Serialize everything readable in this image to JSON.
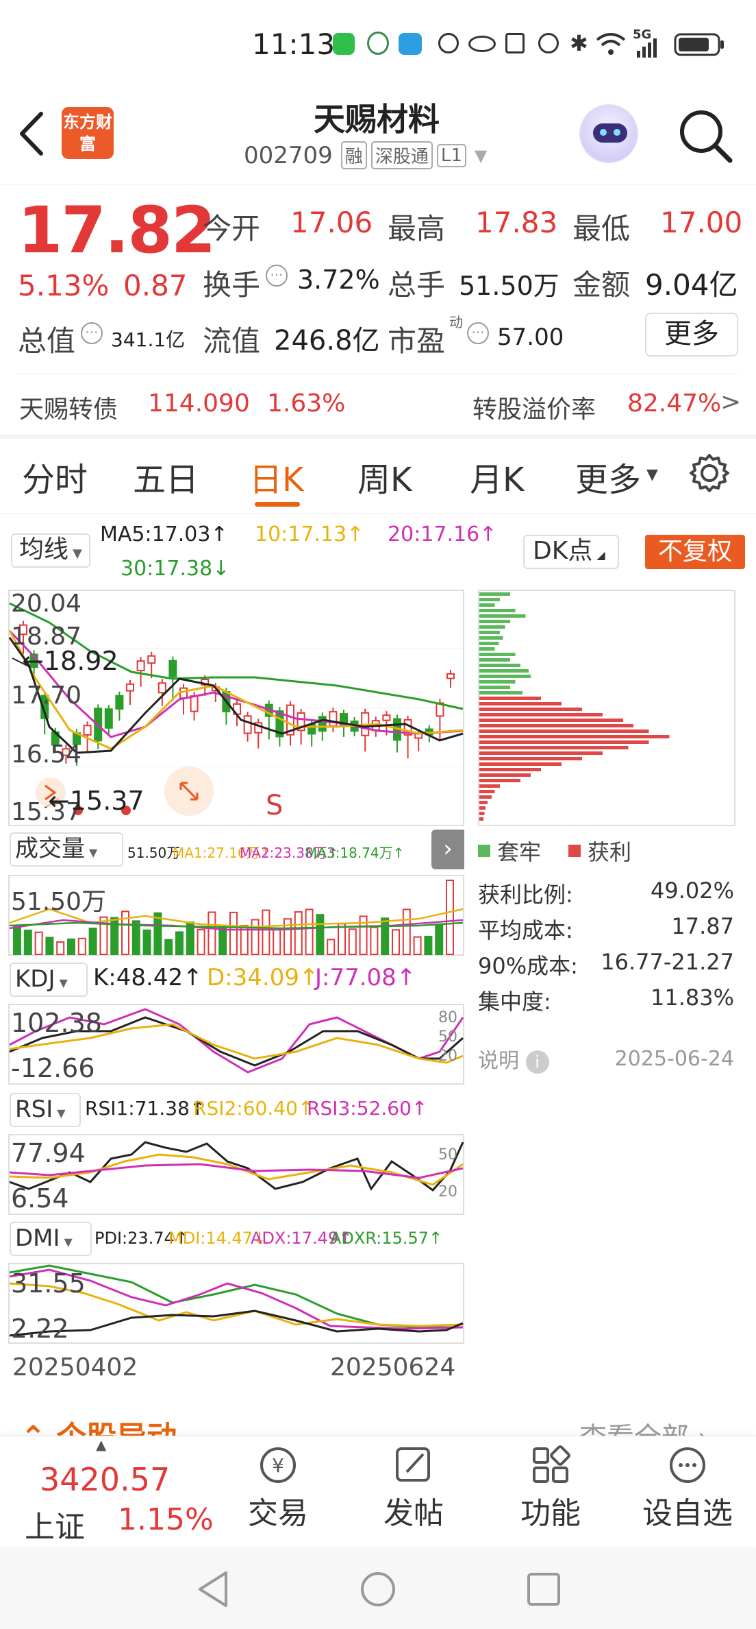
{
  "status_bar": {
    "time": "11:13",
    "network": "5G"
  },
  "header": {
    "logo_text": "东方财富",
    "stock_name": "天赐材料",
    "stock_code": "002709",
    "tags": [
      "融",
      "深股通",
      "L1"
    ]
  },
  "quote": {
    "price": "17.82",
    "change_pct": "5.13%",
    "change": "0.87",
    "open_label": "今开",
    "open": "17.06",
    "high_label": "最高",
    "high": "17.83",
    "low_label": "最低",
    "low": "17.00",
    "turnover_label": "换手",
    "turnover": "3.72%",
    "volume_label": "总手",
    "volume": "51.50万",
    "amount_label": "金额",
    "amount": "9.04亿",
    "mcap_label": "总值",
    "mcap": "341.1亿",
    "float_label": "流值",
    "float_val": "246.8亿",
    "pe_label": "市盈",
    "pe_sup": "动",
    "pe": "57.00",
    "more_label": "更多"
  },
  "bond": {
    "name": "天赐转债",
    "price": "114.090",
    "pct": "1.63%",
    "premium_label": "转股溢价率",
    "premium": "82.47%"
  },
  "tabs": [
    "分时",
    "五日",
    "日K",
    "周K",
    "月K",
    "更多"
  ],
  "active_tab": "日K",
  "ma_bar": {
    "selector": "均线",
    "ma5": "MA5:17.03↑",
    "ma10": "10:17.13↑",
    "ma20": "20:17.16↑",
    "ma30": "30:17.38↓",
    "dk": "DK点",
    "fq": "不复权"
  },
  "kline": {
    "axis": [
      "20.04",
      "18.87",
      "17.70",
      "16.54",
      "15.37"
    ],
    "high_mark": "18.92",
    "low_mark": "15.37",
    "s_mark": "S"
  },
  "volume": {
    "selector": "成交量",
    "vol": "51.50万",
    "ma1": "MA1:27.16万↑",
    "ma2": "MA2:23.38万↑",
    "ma3": "MA3:18.74万↑",
    "axis": "51.50万"
  },
  "kdj": {
    "selector": "KDJ",
    "k": "K:48.42↑",
    "d": "D:34.09↑",
    "j": "J:77.08↑",
    "top": "102.38",
    "bottom": "-12.66",
    "r1": "80",
    "r2": "50",
    "r3": "20"
  },
  "rsi": {
    "selector": "RSI",
    "r1": "RSI1:71.38↑",
    "r2": "RSI2:60.40↑",
    "r3": "RSI3:52.60↑",
    "top": "77.94",
    "bottom": "6.54",
    "ref1": "50",
    "ref2": "20"
  },
  "dmi": {
    "selector": "DMI",
    "pdi": "PDI:23.74↑",
    "mdi": "MDI:14.47↓",
    "adx": "ADX:17.49↑",
    "adxr": "ADXR:15.57↑",
    "top": "31.55",
    "bottom": "2.22"
  },
  "dates": {
    "start": "20250402",
    "end": "20250624"
  },
  "chip": {
    "legend_trapped": "套牢",
    "legend_profit": "获利",
    "rows": [
      {
        "label": "获利比例:",
        "value": "49.02%"
      },
      {
        "label": "平均成本:",
        "value": "17.87"
      },
      {
        "label": "90%成本:",
        "value": "16.77-21.27"
      },
      {
        "label": "集中度:",
        "value": "11.83%"
      }
    ],
    "note_label": "说明",
    "date": "2025-06-24"
  },
  "section": {
    "title": "个股异动",
    "view_all": "查看全部"
  },
  "bottom_nav": {
    "index_value": "3420.57",
    "index_name": "上证",
    "index_pct": "1.15%",
    "items": [
      "交易",
      "发帖",
      "功能",
      "设自选"
    ]
  },
  "colors": {
    "up": "#e23838",
    "down": "#2a9d2a",
    "accent": "#e8630c"
  }
}
